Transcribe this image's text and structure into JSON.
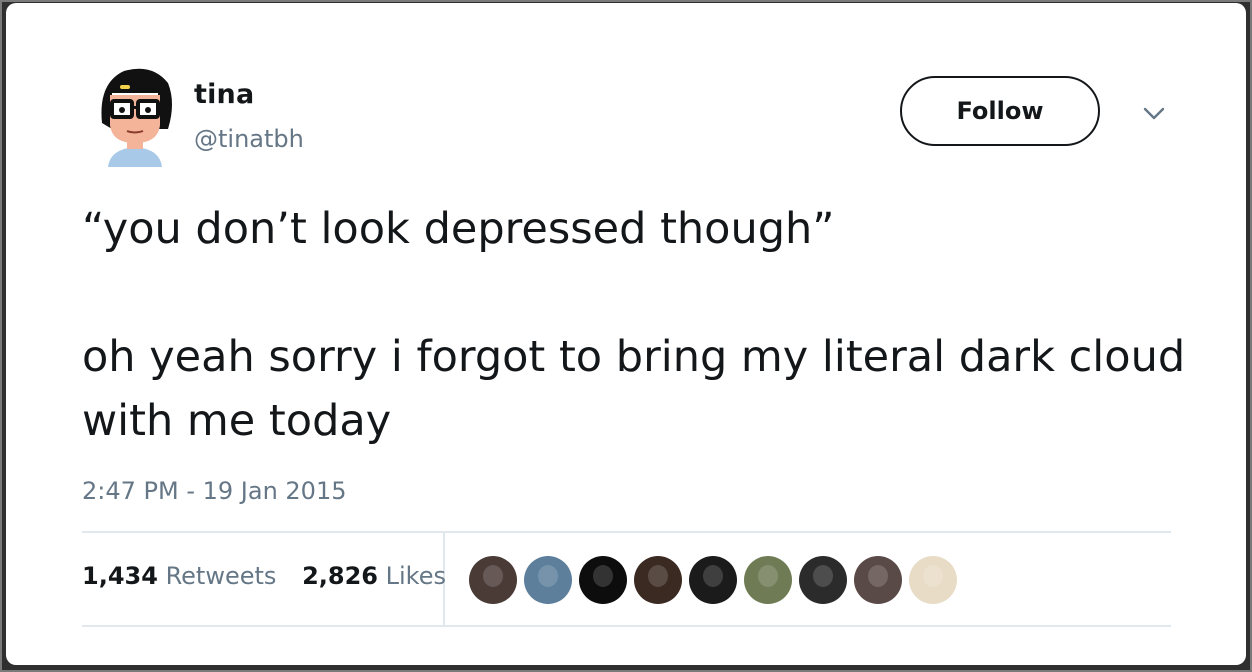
{
  "user": {
    "display_name": "tina",
    "handle": "@tinatbh",
    "avatar_icon": "cartoon-girl-with-glasses-avatar"
  },
  "follow_button": {
    "label": "Follow"
  },
  "menu": {
    "icon": "chevron-down-icon"
  },
  "tweet": {
    "line1": "“you don’t look depressed though”",
    "line2": "oh yeah sorry i forgot to bring my literal dark cloud with me today"
  },
  "timestamp": "2:47 PM - 19 Jan 2015",
  "stats": {
    "retweets_count": "1,434",
    "retweets_label": "Retweets",
    "likes_count": "2,826",
    "likes_label": "Likes"
  },
  "likers": [
    {
      "color": "#4a3b36"
    },
    {
      "color": "#5d7f9c"
    },
    {
      "color": "#0d0d0d"
    },
    {
      "color": "#3a2a22"
    },
    {
      "color": "#1b1b1b"
    },
    {
      "color": "#6f7b55"
    },
    {
      "color": "#2b2b2b"
    },
    {
      "color": "#5a4a47"
    },
    {
      "color": "#e9dcc6"
    }
  ],
  "colors": {
    "text": "#14171a",
    "secondary_text": "#657786",
    "divider": "#e1e8ed"
  }
}
